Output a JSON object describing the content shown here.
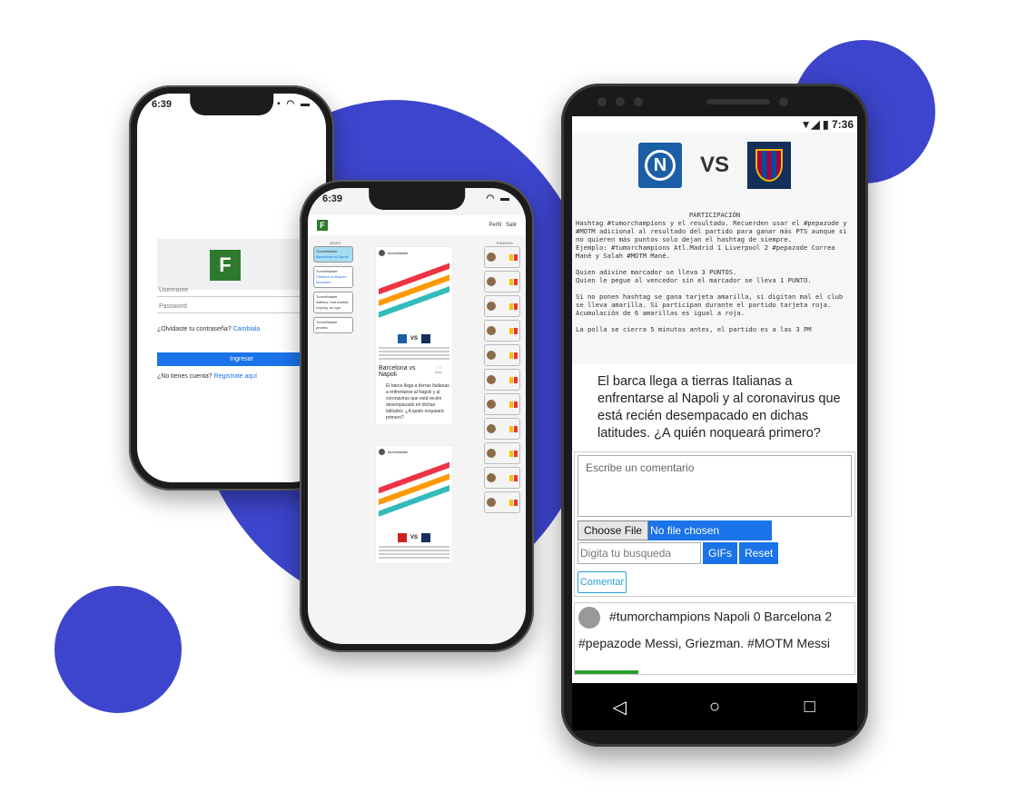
{
  "login": {
    "time": "6:39",
    "username_placeholder": "Username",
    "password_placeholder": "Password",
    "forgot_text": "¿Olvidaste tu contraseña?",
    "forgot_link": "Cambiala",
    "login_button": "Ingresar",
    "register_text": "¿No tienes cuenta?",
    "register_link": "Registrate aquí"
  },
  "feed": {
    "time": "6:39",
    "nav_profile": "Perfil",
    "nav_logout": "Salir",
    "col_news": "NEWS",
    "col_ranking": "RANKING",
    "user": "tumorMaster",
    "post1_title": "Barcelona vs Napoli",
    "post1_likes": "♡ 1 likes",
    "post1_body": "El barca llega a tierras Italianas a enfrentarse al Napoli y al coronavirus que está recién desempacado en dichas latitudes. ¿A quién noqueará primero?",
    "left_cards": [
      {
        "title": "TumorMaster",
        "text": "Barcelona vs Napoli"
      },
      {
        "title": "TumorMaster",
        "text": "Chelsea vs Bayern Munchen"
      },
      {
        "title": "TumorMaster",
        "text": "Atlético, real madrid, Leipzig, la Liga"
      },
      {
        "title": "TumorMaster",
        "text": "prueba"
      }
    ]
  },
  "detail": {
    "time": "7:36",
    "vs_label": "VS",
    "participation_title": "PARTICIPACIÓN",
    "participation_text": "Hashtag #tumorchampions y el resultado. Recuerden usar el #pepazode y #MOTM adicional al resultado del partido para ganar más PTS aunque si no quieren más puntos solo dejan el hashtag de siempre.\nEjemplo: #tumorchampions Atl.Madrid 1 Liverpool 2 #pepazode Correa Mané y Salah #MOTM Mané.\n\nQuien adivine marcador se lleva 3 PUNTOS.\nQuien le pegue al vencedor sin el marcador se lleva 1 PUNTO.\n\nSi no ponen hashtag se gana tarjeta amarilla, si digitan mal el club se lleva amarilla. Si participan durante el partido tarjeta roja. Acumulación de 6 amarillas es igual a roja.\n\nLa polla se cierra 5 minutos antes, el partido es a las 3 PM",
    "description": "El barca llega a tierras Italianas a enfrentarse al Napoli y al coronavirus que está recién desempacado en dichas latitudes. ¿A quién noqueará primero?",
    "comment_placeholder": "Escribe un comentario",
    "choose_file": "Choose File",
    "no_file": "No file chosen",
    "gif_search_placeholder": "Digita tu busqueda",
    "gifs_button": "GIFs",
    "reset_button": "Reset",
    "comment_button": "Comentar",
    "comment_line1": "#tumorchampions Napoli 0 Barcelona 2",
    "comment_line2": "#pepazode Messi, Griezman. #MOTM Messi"
  },
  "colors": {
    "accent": "#3d45cc",
    "button_blue": "#1a73e8"
  }
}
